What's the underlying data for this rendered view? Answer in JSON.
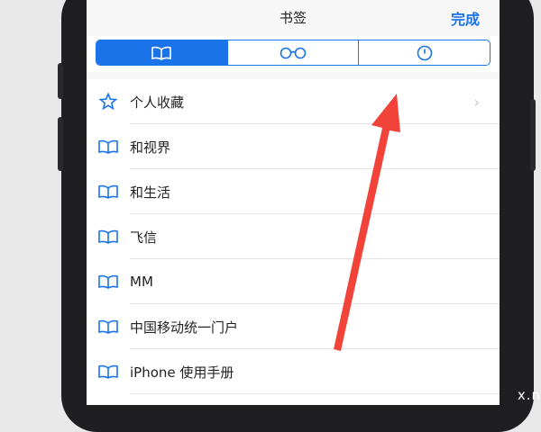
{
  "header": {
    "title": "书签",
    "done_label": "完成"
  },
  "segments": [
    {
      "icon": "book-icon",
      "active": true
    },
    {
      "icon": "reading-glasses-icon",
      "active": false
    },
    {
      "icon": "clock-icon",
      "active": false
    }
  ],
  "bookmarks": [
    {
      "label": "个人收藏",
      "icon": "star-icon",
      "has_chevron": true
    },
    {
      "label": "和视界",
      "icon": "book-icon"
    },
    {
      "label": "和生活",
      "icon": "book-icon"
    },
    {
      "label": "飞信",
      "icon": "book-icon"
    },
    {
      "label": "MM",
      "icon": "book-icon"
    },
    {
      "label": "中国移动统一门户",
      "icon": "book-icon"
    },
    {
      "label": "iPhone 使用手册",
      "icon": "book-icon"
    }
  ],
  "watermark": "x.n",
  "colors": {
    "accent": "#1a73e8",
    "annotation_arrow": "#f2433a"
  }
}
